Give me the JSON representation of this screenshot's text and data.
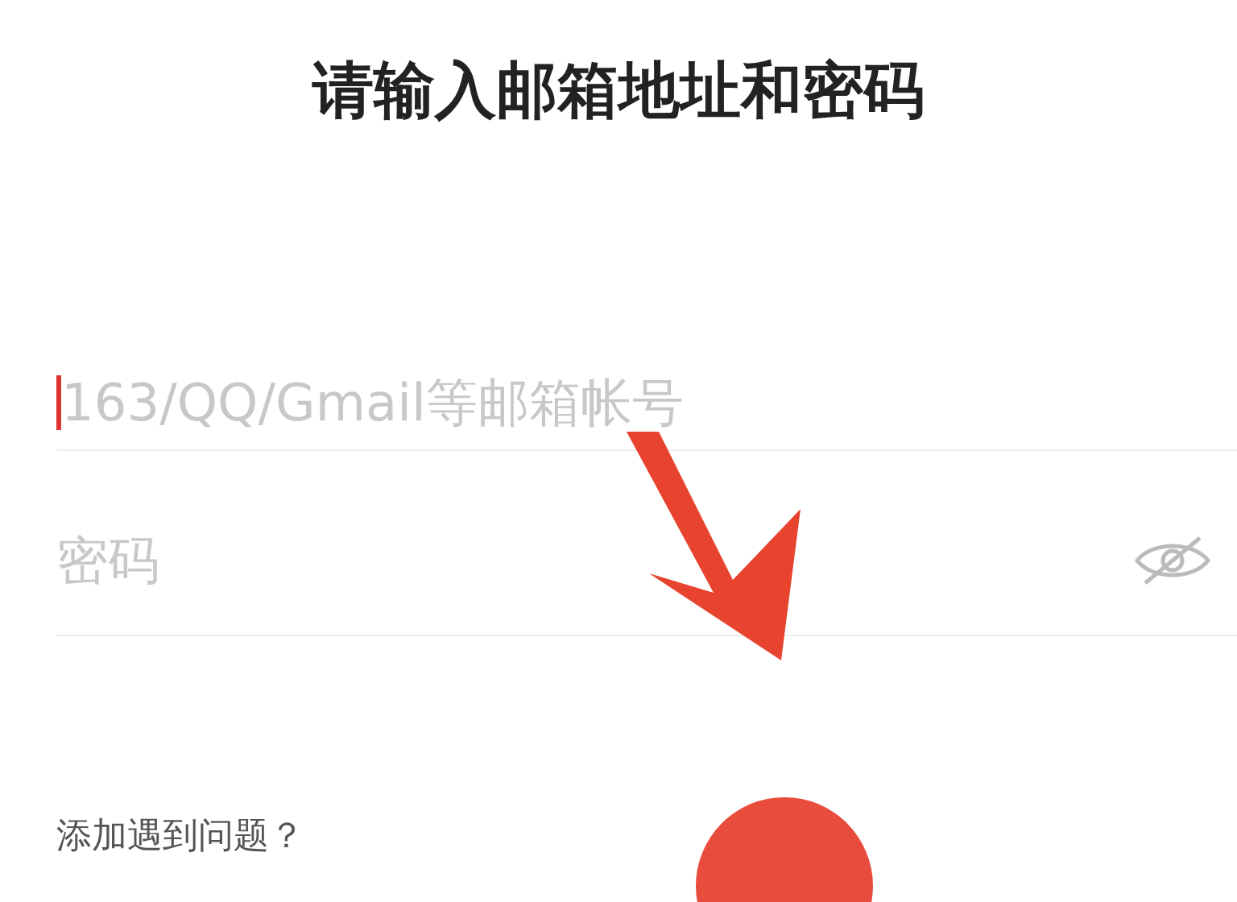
{
  "title": "请输入邮箱地址和密码",
  "email_field": {
    "placeholder": "163/QQ/Gmail等邮箱帐号",
    "focused": true
  },
  "password_field": {
    "placeholder": "密码",
    "password_hidden": true
  },
  "help_link": "添加遇到问题？"
}
